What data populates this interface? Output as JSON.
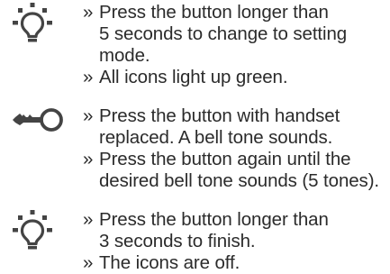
{
  "steps": [
    {
      "icon": "light-bulb-icon",
      "lines": [
        {
          "marker": "»",
          "text": "Press the button longer than"
        },
        {
          "marker": "",
          "text": "5 seconds to change to setting"
        },
        {
          "marker": "",
          "text": "mode."
        },
        {
          "marker": "»",
          "text": "All icons light up green."
        }
      ]
    },
    {
      "icon": "key-icon",
      "lines": [
        {
          "marker": "»",
          "text": "Press the button with handset"
        },
        {
          "marker": "",
          "text": "replaced. A bell tone sounds."
        },
        {
          "marker": "»",
          "text": "Press the button again until the"
        },
        {
          "marker": "",
          "text": "desired bell tone sounds (5 tones)."
        }
      ]
    },
    {
      "icon": "light-bulb-icon",
      "lines": [
        {
          "marker": "»",
          "text": "Press the button longer than"
        },
        {
          "marker": "",
          "text": "3 seconds to finish."
        },
        {
          "marker": "»",
          "text": "The icons are off."
        }
      ]
    }
  ]
}
